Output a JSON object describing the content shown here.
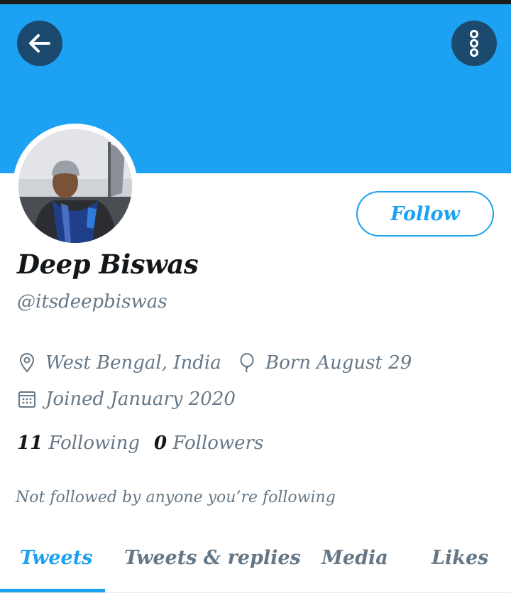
{
  "header": {
    "back_icon": "arrow-left-icon",
    "more_icon": "more-vertical-icon",
    "banner_color": "#1da1f2"
  },
  "profile": {
    "name": "Deep Biswas",
    "handle": "@itsdeepbiswas",
    "follow_label": "Follow",
    "location": "West Bengal, India",
    "birthday": "Born August 29",
    "joined": "Joined January 2020",
    "following_count": "11",
    "following_label": "Following",
    "followers_count": "0",
    "followers_label": "Followers",
    "not_followed_text": "Not followed by anyone you’re following"
  },
  "tabs": [
    {
      "label": "Tweets",
      "active": true
    },
    {
      "label": "Tweets & replies",
      "active": false
    },
    {
      "label": "Media",
      "active": false
    },
    {
      "label": "Likes",
      "active": false
    }
  ],
  "colors": {
    "accent": "#1da1f2",
    "text_primary": "#14171a",
    "text_secondary": "#657786"
  }
}
